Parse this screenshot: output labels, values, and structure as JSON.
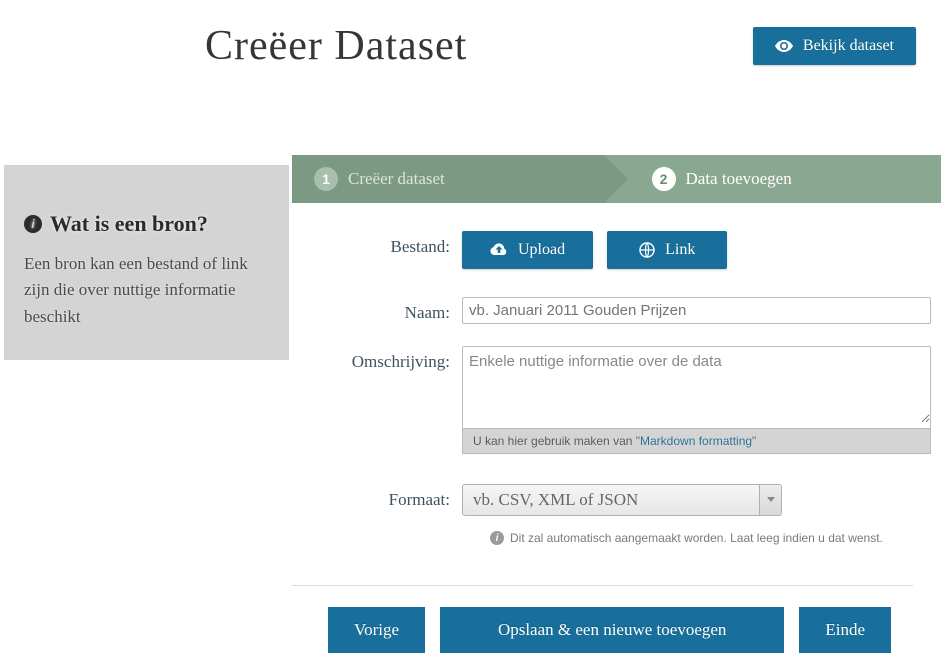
{
  "header": {
    "title": "Creëer Dataset",
    "view_button": "Bekijk dataset"
  },
  "sidebar": {
    "heading": "Wat is een bron?",
    "body": "Een bron kan een bestand of link zijn die over nuttige informatie beschikt"
  },
  "stages": {
    "step1": {
      "num": "1",
      "label": "Creëer dataset"
    },
    "step2": {
      "num": "2",
      "label": "Data toevoegen"
    }
  },
  "form": {
    "file_label": "Bestand:",
    "upload_btn": "Upload",
    "link_btn": "Link",
    "name_label": "Naam:",
    "name_placeholder": "vb. Januari 2011 Gouden Prijzen",
    "desc_label": "Omschrijving:",
    "desc_placeholder": "Enkele nuttige informatie over de data",
    "markdown_hint_prefix": "U kan hier gebruik maken van ",
    "markdown_link": "\"Markdown formatting\"",
    "format_label": "Formaat:",
    "format_placeholder": "vb. CSV, XML of JSON",
    "format_hint": "Dit zal automatisch aangemaakt worden. Laat leeg indien u dat wenst."
  },
  "footer": {
    "previous": "Vorige",
    "save_add": "Opslaan & een nieuwe toevoegen",
    "finish": "Einde"
  }
}
